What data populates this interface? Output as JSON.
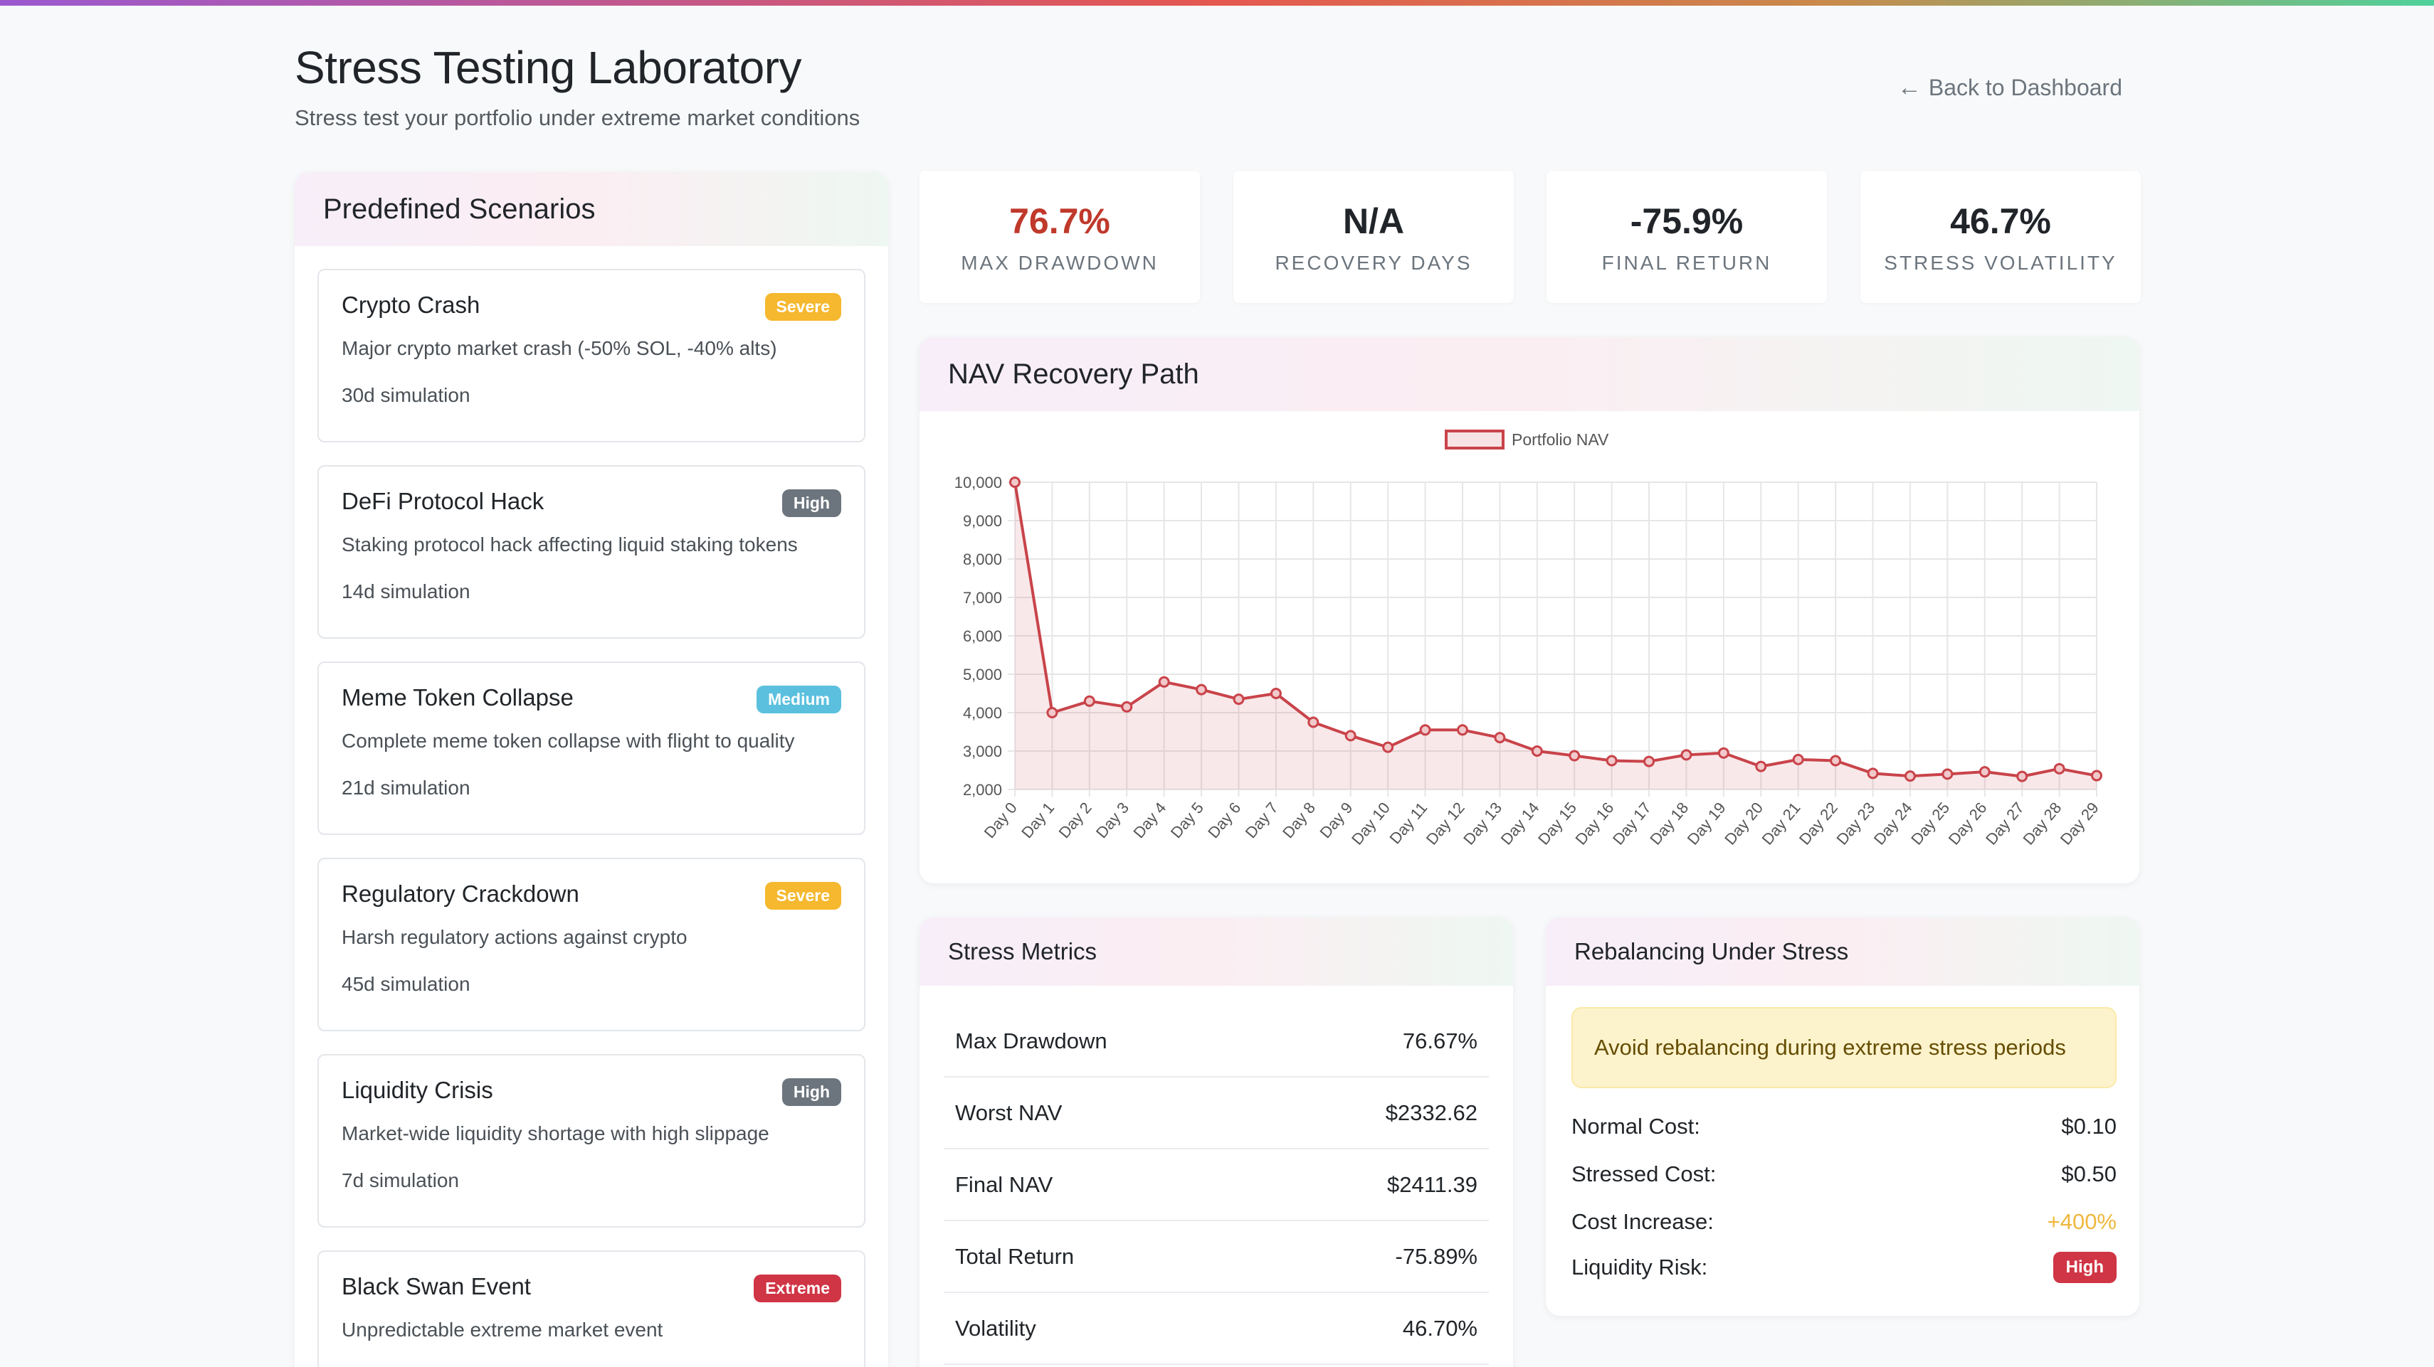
{
  "header": {
    "title": "Stress Testing Laboratory",
    "subtitle": "Stress test your portfolio under extreme market conditions",
    "back_label": "Back to Dashboard"
  },
  "scenarios": {
    "title": "Predefined Scenarios",
    "items": [
      {
        "name": "Crypto Crash",
        "badge": "Severe",
        "badge_color": "#f5b82e",
        "description": "Major crypto market crash (-50% SOL, -40% alts)",
        "duration": "30d simulation"
      },
      {
        "name": "DeFi Protocol Hack",
        "badge": "High",
        "badge_color": "#6c757d",
        "description": "Staking protocol hack affecting liquid staking tokens",
        "duration": "14d simulation"
      },
      {
        "name": "Meme Token Collapse",
        "badge": "Medium",
        "badge_color": "#5bc0de",
        "description": "Complete meme token collapse with flight to quality",
        "duration": "21d simulation"
      },
      {
        "name": "Regulatory Crackdown",
        "badge": "Severe",
        "badge_color": "#f5b82e",
        "description": "Harsh regulatory actions against crypto",
        "duration": "45d simulation"
      },
      {
        "name": "Liquidity Crisis",
        "badge": "High",
        "badge_color": "#6c757d",
        "description": "Market-wide liquidity shortage with high slippage",
        "duration": "7d simulation"
      },
      {
        "name": "Black Swan Event",
        "badge": "Extreme",
        "badge_color": "#d03545",
        "description": "Unpredictable extreme market event",
        "duration": ""
      }
    ]
  },
  "stats": [
    {
      "value": "76.7%",
      "label": "MAX DRAWDOWN",
      "color": "#c0392b"
    },
    {
      "value": "N/A",
      "label": "RECOVERY DAYS",
      "color": "#212529"
    },
    {
      "value": "-75.9%",
      "label": "FINAL RETURN",
      "color": "#212529"
    },
    {
      "value": "46.7%",
      "label": "STRESS VOLATILITY",
      "color": "#212529"
    }
  ],
  "chart_card": {
    "title": "NAV Recovery Path"
  },
  "chart_data": {
    "type": "line",
    "title": "",
    "xlabel": "",
    "ylabel": "",
    "ylim": [
      2000,
      10000
    ],
    "yticks": [
      "10,000",
      "9,000",
      "8,000",
      "7,000",
      "6,000",
      "5,000",
      "4,000",
      "3,000",
      "2,000"
    ],
    "grid": true,
    "legend_position": "top",
    "color": "#c9434a",
    "x": [
      "Day 0",
      "Day 1",
      "Day 2",
      "Day 3",
      "Day 4",
      "Day 5",
      "Day 6",
      "Day 7",
      "Day 8",
      "Day 9",
      "Day 10",
      "Day 11",
      "Day 12",
      "Day 13",
      "Day 14",
      "Day 15",
      "Day 16",
      "Day 17",
      "Day 18",
      "Day 19",
      "Day 20",
      "Day 21",
      "Day 22",
      "Day 23",
      "Day 24",
      "Day 25",
      "Day 26",
      "Day 27",
      "Day 28",
      "Day 29"
    ],
    "series": [
      {
        "name": "Portfolio NAV",
        "values": [
          10000,
          4000,
          4300,
          4150,
          4800,
          4600,
          4350,
          4500,
          3750,
          3400,
          3100,
          3550,
          3550,
          3350,
          3000,
          2880,
          2750,
          2730,
          2900,
          2950,
          2600,
          2780,
          2750,
          2420,
          2350,
          2400,
          2460,
          2340,
          2540,
          2360
        ]
      }
    ]
  },
  "metrics": {
    "title": "Stress Metrics",
    "rows": [
      {
        "label": "Max Drawdown",
        "value": "76.67%"
      },
      {
        "label": "Worst NAV",
        "value": "$2332.62"
      },
      {
        "label": "Final NAV",
        "value": "$2411.39"
      },
      {
        "label": "Total Return",
        "value": "-75.89%"
      },
      {
        "label": "Volatility",
        "value": "46.70%"
      }
    ]
  },
  "rebalancing": {
    "title": "Rebalancing Under Stress",
    "alert": "Avoid rebalancing during extreme stress periods",
    "normal_cost_label": "Normal Cost:",
    "normal_cost": "$0.10",
    "stressed_cost_label": "Stressed Cost:",
    "stressed_cost": "$0.50",
    "cost_increase_label": "Cost Increase:",
    "cost_increase": "+400%",
    "liquidity_risk_label": "Liquidity Risk:",
    "liquidity_risk": "High"
  }
}
